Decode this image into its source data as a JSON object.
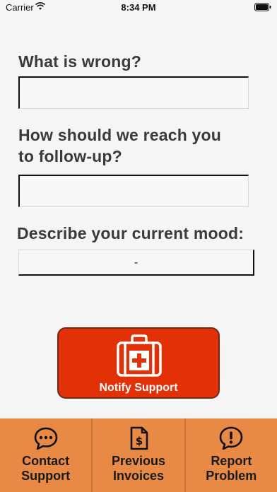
{
  "status_bar": {
    "carrier": "Carrier",
    "time": "8:34 PM"
  },
  "form": {
    "wrong_label": "What is wrong?",
    "wrong_value": "",
    "contact_label_line1": "How should we reach you",
    "contact_label_line2": "to follow-up?",
    "contact_value": "",
    "mood_label": "Describe your current mood:",
    "mood_value": "-"
  },
  "notify_button": {
    "label": "Notify Support",
    "icon": "first-aid-kit-icon"
  },
  "tabs": [
    {
      "line1": "Contact",
      "line2": "Support",
      "icon": "chat-bubble-icon"
    },
    {
      "line1": "Previous",
      "line2": "Invoices",
      "icon": "invoice-icon"
    },
    {
      "line1": "Report",
      "line2": "Problem",
      "icon": "alert-bubble-icon"
    }
  ],
  "colors": {
    "accent": "#e23106",
    "tab_bar": "#e88a45",
    "label": "#3a3a3a"
  }
}
